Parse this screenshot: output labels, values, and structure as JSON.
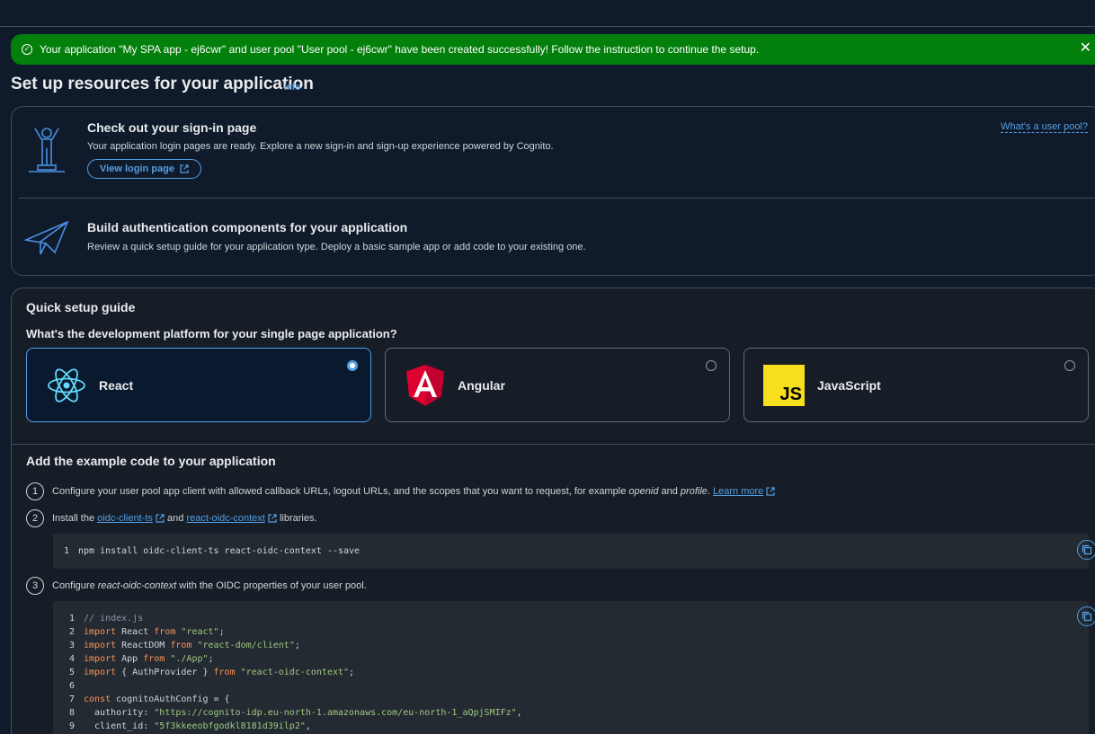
{
  "flash": {
    "message": "Your application \"My SPA app - ej6cwr\" and user pool \"User pool - ej6cwr\" have been created successfully! Follow the instruction to continue the setup."
  },
  "page": {
    "title": "Set up resources for your application",
    "info": "Info"
  },
  "signin": {
    "title": "Check out your sign-in page",
    "desc": "Your application login pages are ready. Explore a new sign-in and sign-up experience powered by Cognito.",
    "button": "View login page",
    "whats_link": "What's a user pool?"
  },
  "build": {
    "title": "Build authentication components for your application",
    "desc": "Review a quick setup guide for your application type. Deploy a basic sample app or add code to your existing one."
  },
  "quick": {
    "title": "Quick setup guide",
    "question": "What's the development platform for your single page application?",
    "options": [
      {
        "label": "React",
        "selected": true
      },
      {
        "label": "Angular",
        "selected": false
      },
      {
        "label": "JavaScript",
        "selected": false
      }
    ],
    "js_logo": "JS"
  },
  "example": {
    "title": "Add the example code to your application",
    "step1": {
      "num": "1",
      "text_a": "Configure your user pool app client with allowed callback URLs, logout URLs, and the scopes that you want to request, for example ",
      "em1": "openid",
      "text_b": " and ",
      "em2": "profile",
      "text_c": ".",
      "link": "Learn more"
    },
    "step2": {
      "num": "2",
      "text_a": "Install the ",
      "link1": "oidc-client-ts",
      "text_b": " and ",
      "link2": "react-oidc-context",
      "text_c": " libraries.",
      "code_ln": "1",
      "code": "npm install oidc-client-ts react-oidc-context --save"
    },
    "step3": {
      "num": "3",
      "text_a": "Configure ",
      "em": "react-oidc-context",
      "text_b": " with the OIDC properties of your user pool."
    }
  },
  "code3": [
    {
      "n": "1",
      "parts": [
        {
          "c": "cm",
          "t": "// index.js"
        }
      ]
    },
    {
      "n": "2",
      "parts": [
        {
          "c": "kw",
          "t": "import"
        },
        {
          "c": "",
          "t": " React "
        },
        {
          "c": "kw",
          "t": "from"
        },
        {
          "c": "",
          "t": " "
        },
        {
          "c": "str",
          "t": "\"react\""
        },
        {
          "c": "",
          "t": ";"
        }
      ]
    },
    {
      "n": "3",
      "parts": [
        {
          "c": "kw",
          "t": "import"
        },
        {
          "c": "",
          "t": " ReactDOM "
        },
        {
          "c": "kw",
          "t": "from"
        },
        {
          "c": "",
          "t": " "
        },
        {
          "c": "str",
          "t": "\"react-dom/client\""
        },
        {
          "c": "",
          "t": ";"
        }
      ]
    },
    {
      "n": "4",
      "parts": [
        {
          "c": "kw",
          "t": "import"
        },
        {
          "c": "",
          "t": " App "
        },
        {
          "c": "kw",
          "t": "from"
        },
        {
          "c": "",
          "t": " "
        },
        {
          "c": "str",
          "t": "\"./App\""
        },
        {
          "c": "",
          "t": ";"
        }
      ]
    },
    {
      "n": "5",
      "parts": [
        {
          "c": "kw",
          "t": "import"
        },
        {
          "c": "",
          "t": " { AuthProvider } "
        },
        {
          "c": "kw",
          "t": "from"
        },
        {
          "c": "",
          "t": " "
        },
        {
          "c": "str",
          "t": "\"react-oidc-context\""
        },
        {
          "c": "",
          "t": ";"
        }
      ]
    },
    {
      "n": "6",
      "parts": []
    },
    {
      "n": "7",
      "parts": [
        {
          "c": "kw",
          "t": "const"
        },
        {
          "c": "",
          "t": " cognitoAuthConfig = {"
        }
      ]
    },
    {
      "n": "8",
      "parts": [
        {
          "c": "",
          "t": "  authority: "
        },
        {
          "c": "str",
          "t": "\"https://cognito-idp.eu-north-1.amazonaws.com/eu-north-1_aQpjSMIFz\""
        },
        {
          "c": "",
          "t": ","
        }
      ]
    },
    {
      "n": "9",
      "parts": [
        {
          "c": "",
          "t": "  client_id: "
        },
        {
          "c": "str",
          "t": "\"5f3kkeeobfgodkl8181d39ilp2\""
        },
        {
          "c": "",
          "t": ","
        }
      ]
    }
  ]
}
